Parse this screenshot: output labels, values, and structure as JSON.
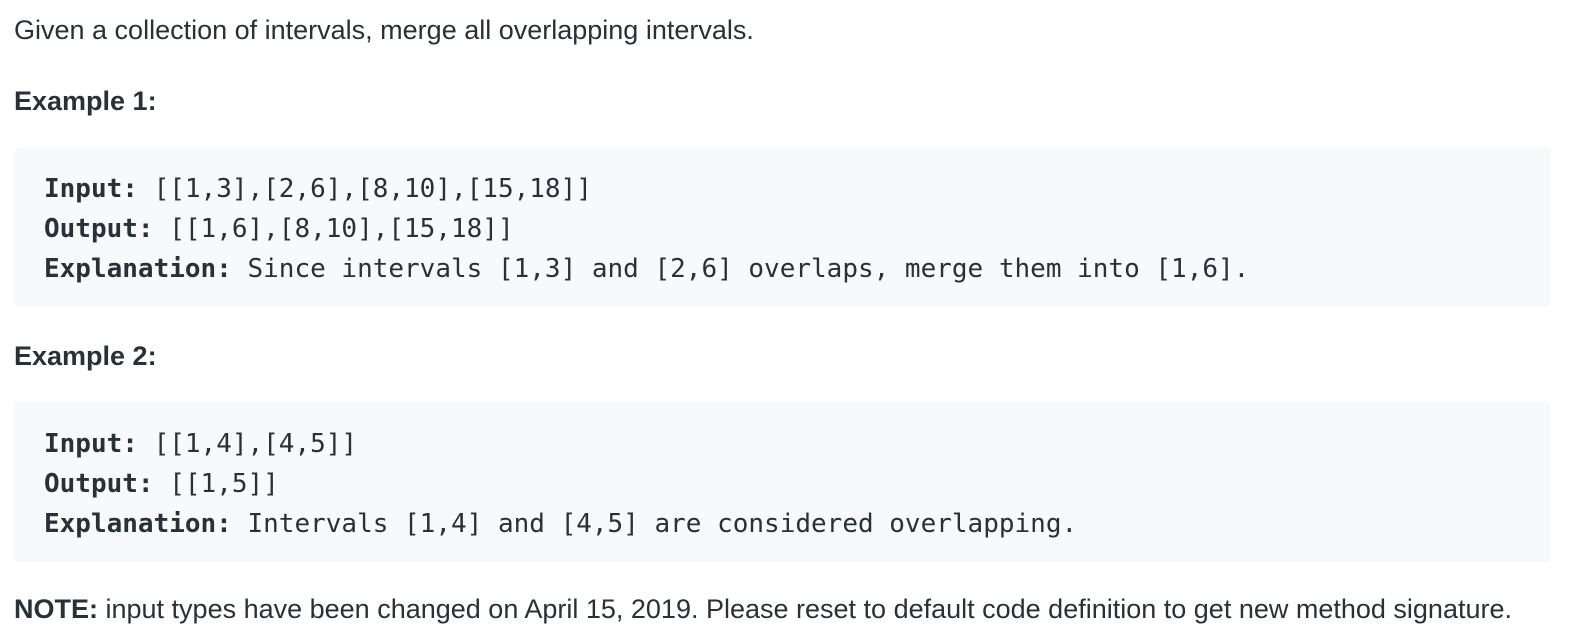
{
  "intro_text": "Given a collection of intervals, merge all overlapping intervals.",
  "examples": [
    {
      "heading": "Example 1:",
      "input_label": "Input:",
      "input_value": " [[1,3],[2,6],[8,10],[15,18]]",
      "output_label": "Output:",
      "output_value": " [[1,6],[8,10],[15,18]]",
      "explanation_label": "Explanation:",
      "explanation_value": " Since intervals [1,3] and [2,6] overlaps, merge them into [1,6]."
    },
    {
      "heading": "Example 2:",
      "input_label": "Input:",
      "input_value": " [[1,4],[4,5]]",
      "output_label": "Output:",
      "output_value": " [[1,5]]",
      "explanation_label": "Explanation:",
      "explanation_value": " Intervals [1,4] and [4,5] are considered overlapping."
    }
  ],
  "note": {
    "label": "NOTE:",
    "text": " input types have been changed on April 15, 2019. Please reset to default code definition to get new method signature."
  },
  "colors": {
    "text": "#263238",
    "code_background": "#f7f9fa",
    "page_background": "#ffffff"
  }
}
